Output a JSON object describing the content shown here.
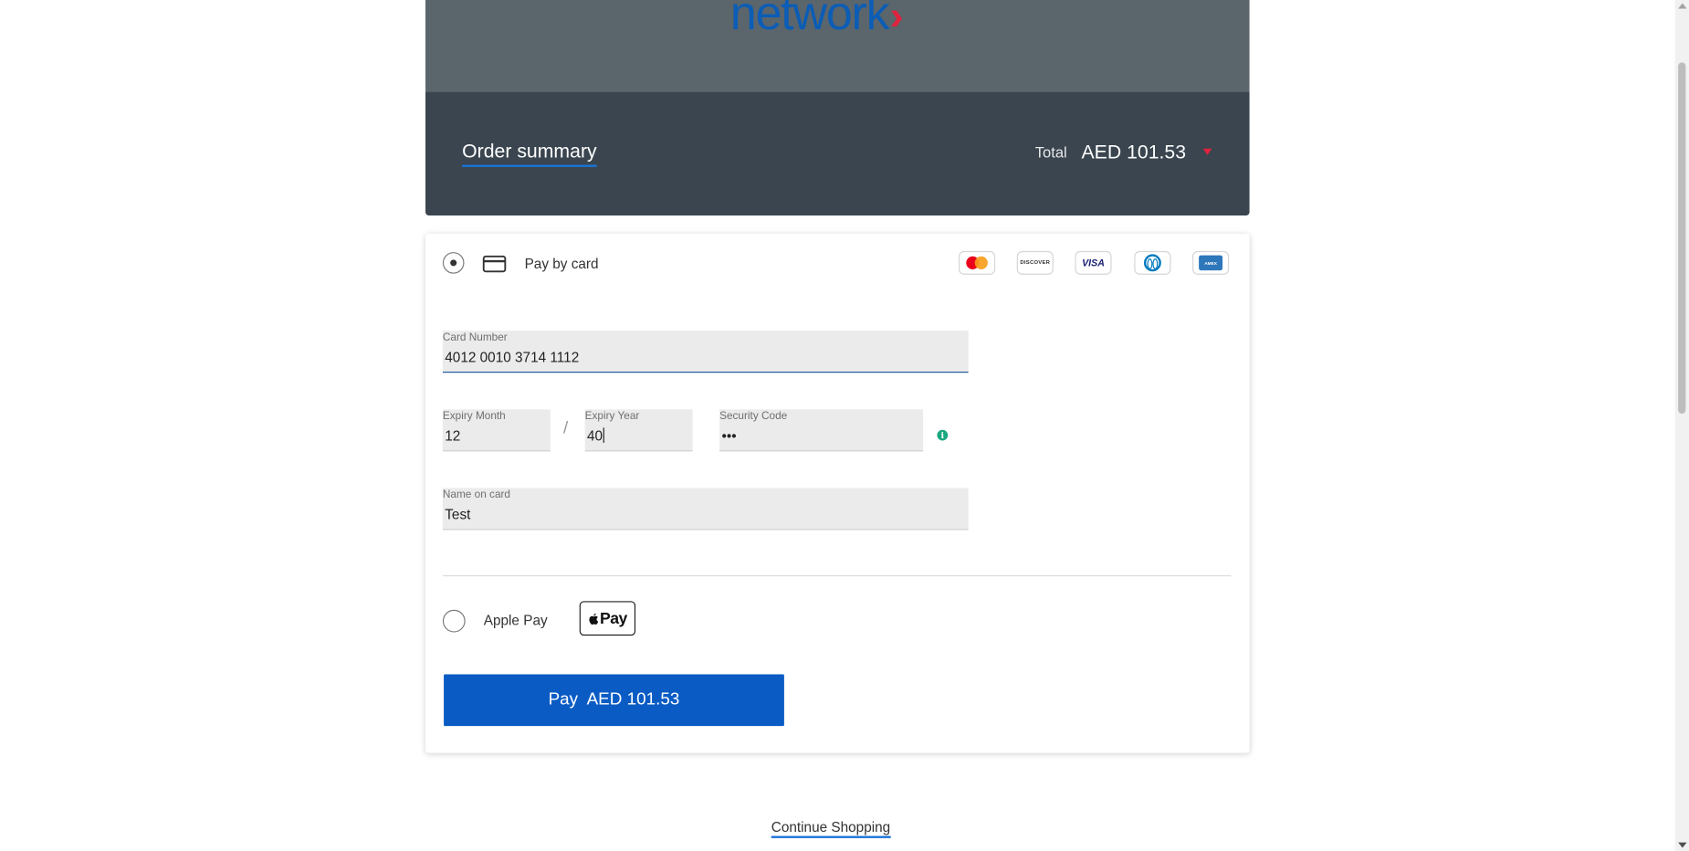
{
  "brand": {
    "logo_text": "network",
    "logo_chevron": "›",
    "colors": {
      "logo_blue": "#0b5db6",
      "logo_chevron": "#e0223d",
      "header_bg": "#5b656c",
      "summary_bg": "#3a454f",
      "accent_blue": "#0a5cc4"
    }
  },
  "summary": {
    "title": "Order summary",
    "total_label": "Total",
    "total_value": "AED 101.53",
    "toggle_icon": "caret-down-icon"
  },
  "payment_methods": {
    "card": {
      "selected": true,
      "icon": "credit-card-icon",
      "label": "Pay by card",
      "brands": [
        {
          "name": "mastercard",
          "icon": "mastercard-icon"
        },
        {
          "name": "discover",
          "icon": "discover-icon",
          "text": "DISCOVER"
        },
        {
          "name": "visa",
          "icon": "visa-icon",
          "text": "VISA"
        },
        {
          "name": "diners",
          "icon": "diners-club-icon"
        },
        {
          "name": "amex",
          "icon": "amex-icon",
          "text": "AMEX"
        }
      ]
    },
    "apple_pay": {
      "selected": false,
      "label": "Apple Pay",
      "badge_text": "Pay",
      "badge_icon": "apple-logo-icon"
    }
  },
  "form": {
    "card_number": {
      "label": "Card Number",
      "value": "4012 0010 3714 1112"
    },
    "expiry_month": {
      "label": "Expiry Month",
      "value": "12"
    },
    "expiry_separator": "/",
    "expiry_year": {
      "label": "Expiry Year",
      "value": "40"
    },
    "security_code": {
      "label": "Security Code",
      "value": "•••",
      "info_icon": "info-icon"
    },
    "name_on_card": {
      "label": "Name on card",
      "value": "Test"
    }
  },
  "pay_button": {
    "prefix": "Pay",
    "amount": "AED 101.53"
  },
  "footer": {
    "continue_link": "Continue Shopping"
  }
}
